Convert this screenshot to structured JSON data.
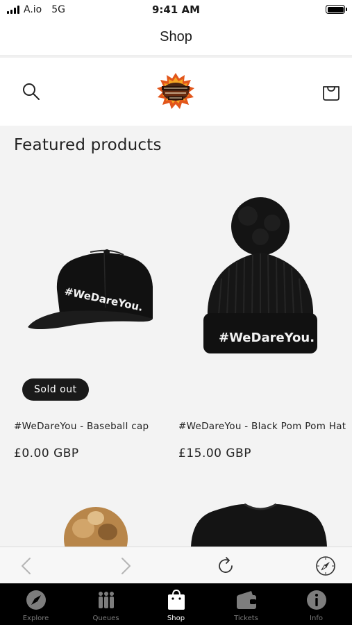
{
  "status_bar": {
    "carrier": "A.io",
    "network": "5G",
    "time": "9:41 AM"
  },
  "nav": {
    "title": "Shop"
  },
  "header": {
    "search_icon": "search-icon",
    "cart_icon": "bag-icon",
    "logo_icon": "festival-logo"
  },
  "main": {
    "section_title": "Featured products",
    "products": [
      {
        "name": "#WeDareYou - Baseball cap",
        "price": "£0.00 GBP",
        "badge": "Sold out",
        "image_text": "#WeDareYou."
      },
      {
        "name": "#WeDareYou - Black Pom Pom Hat",
        "price": "£15.00 GBP",
        "image_text": "#WeDareYou."
      }
    ]
  },
  "browser_toolbar": {
    "icons": [
      "back-icon",
      "forward-icon",
      "reload-icon",
      "compass-icon"
    ]
  },
  "tab_bar": {
    "items": [
      {
        "label": "Explore",
        "icon": "compass-icon"
      },
      {
        "label": "Queues",
        "icon": "people-icon"
      },
      {
        "label": "Shop",
        "icon": "bag-icon"
      },
      {
        "label": "Tickets",
        "icon": "wallet-icon"
      },
      {
        "label": "Info",
        "icon": "info-icon"
      }
    ],
    "active_index": 2
  }
}
